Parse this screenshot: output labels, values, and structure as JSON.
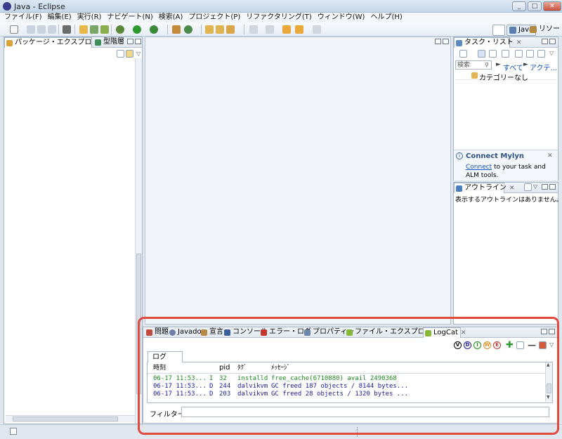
{
  "window": {
    "title": "Java - Eclipse"
  },
  "menu": [
    "ファイル(F)",
    "編集(E)",
    "実行(R)",
    "ナビゲート(N)",
    "検索(A)",
    "プロジェクト(P)",
    "リファクタリング(T)",
    "ウィンドウ(W)",
    "ヘルプ(H)"
  ],
  "perspectives": {
    "java": "Java",
    "resource": "リソー"
  },
  "left_panel": {
    "tab_package": "パッケージ・エクスプロ",
    "tab_hierarchy": "型階層"
  },
  "task_list": {
    "title": "タスク・リスト",
    "search_placeholder": "検索",
    "filter_all": "すべて",
    "filter_active": "アクテ...",
    "category": "カテゴリーなし"
  },
  "mylyn": {
    "title": "Connect Mylyn",
    "link": "Connect",
    "text": " to your task and ALM tools."
  },
  "outline": {
    "title": "アウトライン",
    "empty_message": "表示するアウトラインはありません。"
  },
  "bottom_tabs": [
    "問題",
    "Javadoc",
    "宣言",
    "コンソール",
    "エラー・ログ",
    "プロパティー",
    "ファイル・エクスプローラー",
    "LogCat"
  ],
  "logcat": {
    "subtab": "ログ",
    "level_buttons": [
      "V",
      "D",
      "I",
      "W",
      "E"
    ],
    "columns": {
      "time": "時刻",
      "pid": "pid",
      "tag": "ﾀｸﾞ",
      "message": "ﾒｯｾｰｼﾞ"
    },
    "rows": [
      {
        "time": "06-17 11:53...",
        "level": "I",
        "pid": "32",
        "tag": "installd",
        "message": "free_cache(6710880) avail 2490368",
        "color": "#1e8a1e"
      },
      {
        "time": "06-17 11:53...",
        "level": "D",
        "pid": "244",
        "tag": "dalvikvm",
        "message": "GC freed 187 objects / 8144 bytes...",
        "color": "#1a1aa6"
      },
      {
        "time": "06-17 11:53...",
        "level": "D",
        "pid": "203",
        "tag": "dalvikvm",
        "message": "GC freed 28 objects / 1320 bytes ...",
        "color": "#1a1aa6"
      }
    ],
    "filter_label": "フィルター:"
  },
  "colors": {
    "highlight": "#e04a3f",
    "panel_border": "#a8b8cc",
    "link": "#0b4fbf"
  }
}
